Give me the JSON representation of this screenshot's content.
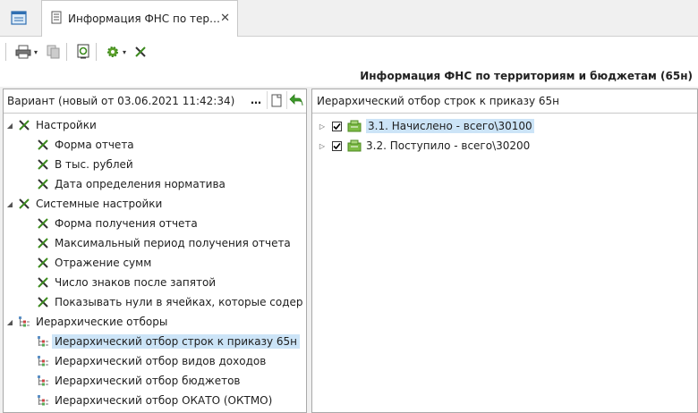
{
  "tabs": {
    "active_title": "Информация ФНС по тер…",
    "close_glyph": "✕"
  },
  "toolbar": {
    "print_caret": "▾",
    "settings_caret": "▾"
  },
  "header": {
    "title": "Информация ФНС по территориям и бюджетам (65н)"
  },
  "left_panel": {
    "variant_label": "Вариант (новый от 03.06.2021 11:42:34)",
    "more_glyph": "…",
    "tree": [
      {
        "label": "Настройки",
        "level": 0,
        "expander": "◢",
        "icon": "tools-icon"
      },
      {
        "label": "Форма отчета",
        "level": 1,
        "icon": "tools-icon"
      },
      {
        "label": "В тыс. рублей",
        "level": 1,
        "icon": "tools-icon"
      },
      {
        "label": "Дата определения норматива",
        "level": 1,
        "icon": "tools-icon"
      },
      {
        "label": "Системные настройки",
        "level": 0,
        "expander": "◢",
        "icon": "tools-icon"
      },
      {
        "label": "Форма получения отчета",
        "level": 1,
        "icon": "tools-icon"
      },
      {
        "label": "Максимальный период получения отчета",
        "level": 1,
        "icon": "tools-icon"
      },
      {
        "label": "Отражение сумм",
        "level": 1,
        "icon": "tools-icon"
      },
      {
        "label": "Число знаков после запятой",
        "level": 1,
        "icon": "tools-icon"
      },
      {
        "label": "Показывать нули в ячейках, которые содер",
        "level": 1,
        "icon": "tools-icon"
      },
      {
        "label": "Иерархические отборы",
        "level": 0,
        "expander": "◢",
        "icon": "hierarchy-icon"
      },
      {
        "label": "Иерархический отбор строк к приказу 65н",
        "level": 1,
        "icon": "hierarchy-icon",
        "selected": true
      },
      {
        "label": "Иерархический отбор видов доходов",
        "level": 1,
        "icon": "hierarchy-icon"
      },
      {
        "label": "Иерархический отбор бюджетов",
        "level": 1,
        "icon": "hierarchy-icon"
      },
      {
        "label": "Иерархический отбор ОКАТО (ОКТМО)",
        "level": 1,
        "icon": "hierarchy-icon"
      }
    ]
  },
  "right_panel": {
    "title": "Иерархический отбор строк к приказу 65н",
    "items": [
      {
        "label": "3.1. Начислено - всего\\30100",
        "expander": "▷",
        "checked": true,
        "selected": true
      },
      {
        "label": "3.2. Поступило - всего\\30200",
        "expander": "▷",
        "checked": true,
        "selected": false
      }
    ]
  },
  "colors": {
    "selection": "#cce4f7",
    "accent_green": "#3c8a1e",
    "back_arrow": "#3c9a2a"
  }
}
